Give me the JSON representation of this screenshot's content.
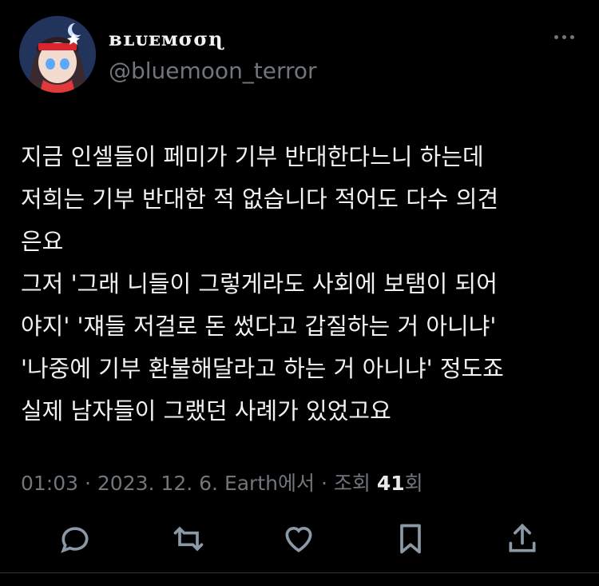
{
  "author": {
    "display_name": "ʙʟᴜᴇᴍσσɳ",
    "handle": "@bluemoon_terror"
  },
  "tweet": {
    "text": "지금 인셀들이 페미가 기부 반대한다느니 하는데\n저희는 기부 반대한 적 없습니다 적어도 다수 의견\n은요\n그저 '그래 니들이 그렇게라도 사회에 보탬이 되어\n야지' '쟤들 저걸로 돈 썼다고 갑질하는 거 아니냐'\n'나중에 기부 환불해달라고 하는 거 아니냐' 정도죠\n실제 남자들이 그랬던 사례가 있었고요"
  },
  "meta": {
    "time": "01:03",
    "date": "2023. 12. 6.",
    "source": "Earth에서",
    "views_label": "조회",
    "views_count": "41",
    "views_suffix": "회",
    "separator": "·"
  },
  "actions": {
    "icons": [
      "reply-icon",
      "retweet-icon",
      "like-icon",
      "bookmark-icon",
      "share-icon"
    ]
  },
  "colors": {
    "background": "#000000",
    "text": "#e7e9ea",
    "muted": "#71767b"
  }
}
